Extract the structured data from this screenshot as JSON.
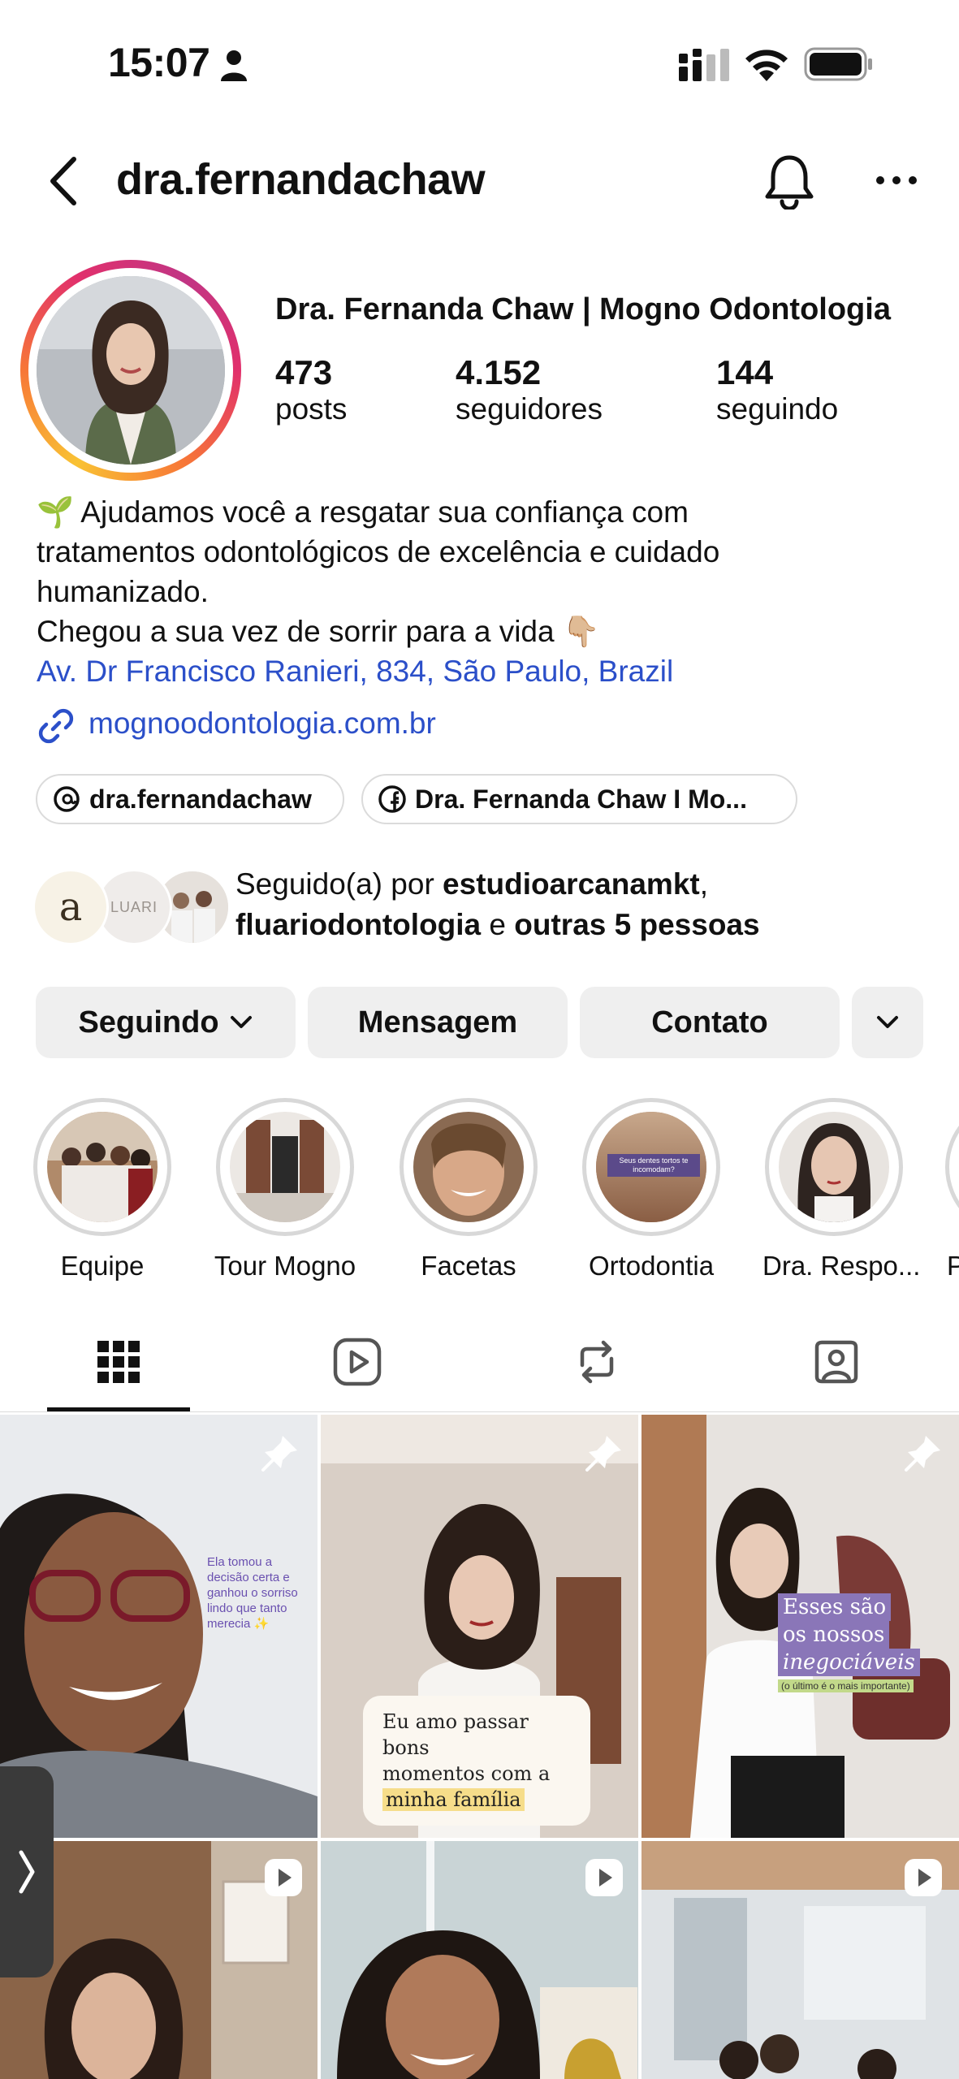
{
  "status_bar": {
    "time": "15:07",
    "icons": [
      "person-icon",
      "signal-icon",
      "wifi-icon",
      "battery-icon"
    ]
  },
  "nav": {
    "username": "dra.fernandachaw",
    "icons": [
      "chevron-left-icon",
      "bell-icon",
      "more-icon"
    ]
  },
  "profile": {
    "display_name": "Dra. Fernanda Chaw | Mogno Odontologia",
    "stats": [
      {
        "value": "473",
        "label": "posts"
      },
      {
        "value": "4.152",
        "label": "seguidores"
      },
      {
        "value": "144",
        "label": "seguindo"
      }
    ],
    "bio": {
      "line1": "🌱 Ajudamos você a resgatar sua confiança com",
      "line2": "tratamentos odontológicos de excelência e cuidado",
      "line3": "humanizado.",
      "line4": "Chegou a sua vez de sorrir para a vida 👇🏼",
      "address": "Av. Dr Francisco Ranieri, 834, São Paulo, Brazil"
    },
    "website": "mognoodontologia.com.br",
    "chips": [
      {
        "icon": "threads-icon",
        "label": "dra.fernandachaw"
      },
      {
        "icon": "facebook-icon",
        "label": "Dra. Fernanda Chaw I Mo..."
      }
    ],
    "followed_by": {
      "prefix": "Seguido(a) por ",
      "name1": "estudioarcanamkt",
      "sep": ",",
      "name2": "fluariodontologia",
      "mid": " e ",
      "others": "outras 5 pessoas",
      "avatar_texts": [
        "a",
        "LUARI"
      ]
    }
  },
  "actions": {
    "following": "Seguindo",
    "message": "Mensagem",
    "contact": "Contato"
  },
  "highlights": [
    {
      "label": "Equipe"
    },
    {
      "label": "Tour Mogno"
    },
    {
      "label": "Facetas"
    },
    {
      "label": "Ortodontia",
      "inner_text": "Seus dentes tortos te incomodam?"
    },
    {
      "label": "Dra. Respo..."
    },
    {
      "label": "P"
    }
  ],
  "tabs": [
    "grid-icon",
    "reels-icon",
    "reposts-icon",
    "tagged-icon"
  ],
  "posts": {
    "post1_text": "Ela tomou a decisão certa e ganhou o sorriso lindo que tanto merecia ✨",
    "post2_line1": "Eu amo passar bons",
    "post2_line2": "momentos com a",
    "post2_line3": "minha família",
    "post3_line1": "Esses são",
    "post3_line2": "os nossos",
    "post3_line3": "inegociáveis",
    "post3_note": "(o último é o mais importante)"
  },
  "colors": {
    "link": "#2b4fc9",
    "button_bg": "#efefef",
    "accent_gradient": [
      "#f9c234",
      "#f77737",
      "#e1306c",
      "#c13584"
    ]
  }
}
